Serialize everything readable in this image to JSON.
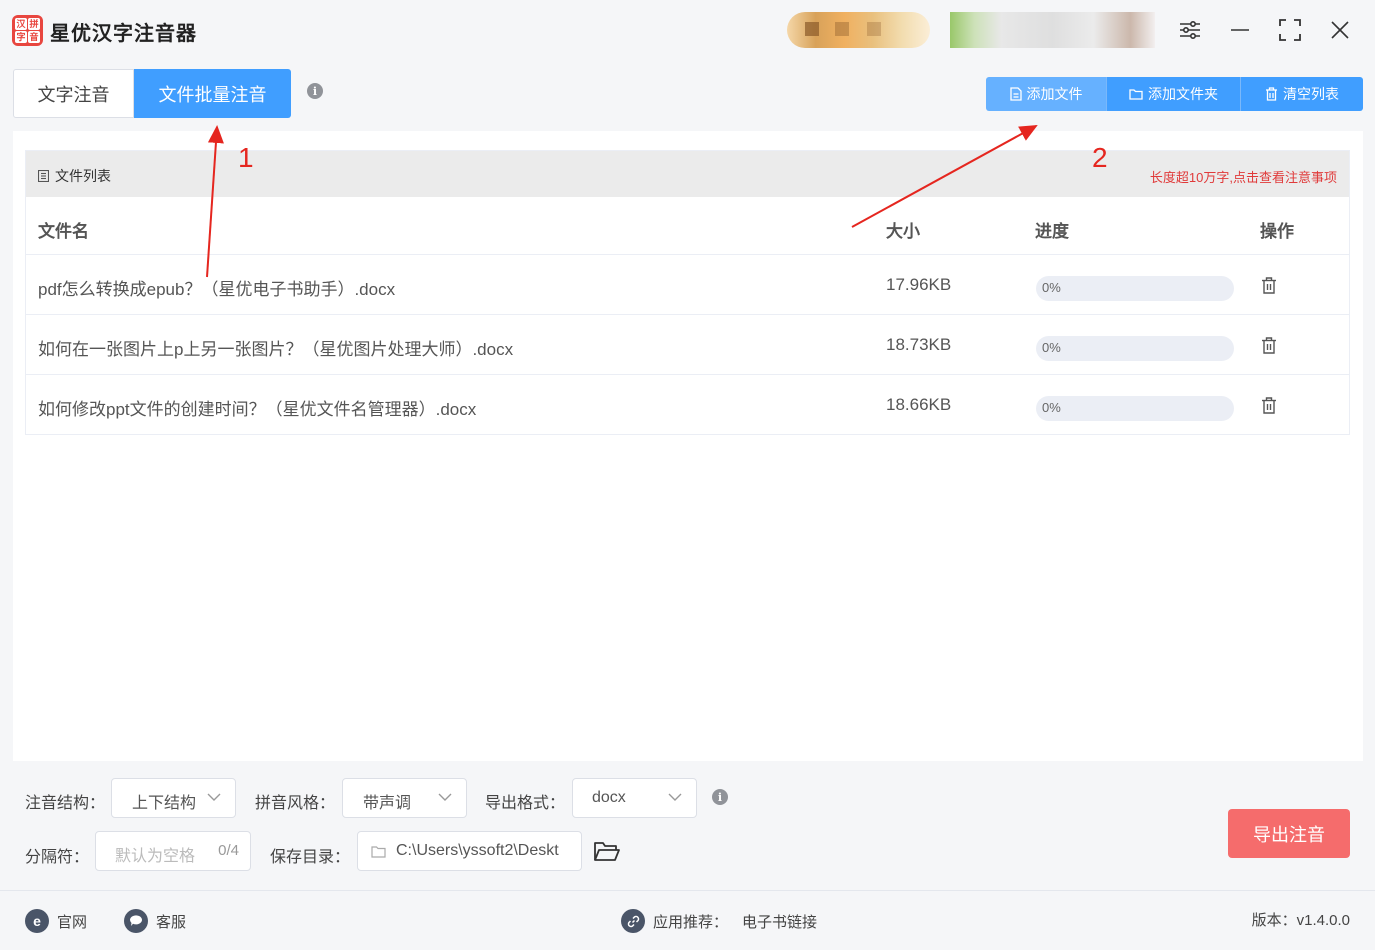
{
  "app": {
    "title": "星优汉字注音器",
    "icon_chars": [
      "汉",
      "拼",
      "字",
      "音"
    ]
  },
  "tabs": [
    {
      "label": "文字注音",
      "active": false
    },
    {
      "label": "文件批量注音",
      "active": true
    }
  ],
  "toolbar": {
    "add_file": "添加文件",
    "add_folder": "添加文件夹",
    "clear_list": "清空列表"
  },
  "file_panel": {
    "title": "文件列表",
    "notice": "长度超10万字,点击查看注意事项",
    "columns": {
      "name": "文件名",
      "size": "大小",
      "progress": "进度",
      "action": "操作"
    },
    "rows": [
      {
        "name": "pdf怎么转换成epub？（星优电子书助手）.docx",
        "size": "17.96KB",
        "progress": "0%"
      },
      {
        "name": "如何在一张图片上p上另一张图片？（星优图片处理大师）.docx",
        "size": "18.73KB",
        "progress": "0%"
      },
      {
        "name": "如何修改ppt文件的创建时间？（星优文件名管理器）.docx",
        "size": "18.66KB",
        "progress": "0%"
      }
    ]
  },
  "annotations": {
    "one": "1",
    "two": "2"
  },
  "options": {
    "structure_label": "注音结构：",
    "structure_value": "上下结构",
    "pinyin_label": "拼音风格：",
    "pinyin_value": "带声调",
    "format_label": "导出格式：",
    "format_value": "docx",
    "separator_label": "分隔符：",
    "separator_placeholder": "默认为空格",
    "separator_count": "0/4",
    "dir_label": "保存目录：",
    "dir_value": "C:\\Users\\yssoft2\\Deskt"
  },
  "export_button": "导出注音",
  "footer": {
    "website": "官网",
    "service": "客服",
    "recommend_label": "应用推荐：",
    "recommend_link": "电子书链接",
    "version": "版本：v1.4.0.0"
  },
  "colors": {
    "primary": "#409eff",
    "export": "#f56c6c",
    "annotation": "#e5261f"
  }
}
